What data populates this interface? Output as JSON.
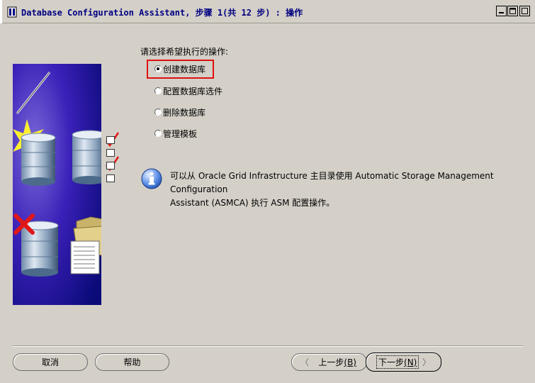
{
  "window": {
    "title": "Database Configuration Assistant, 步骤 1(共 12 步) : 操作",
    "minimize_icon": "minimize-icon",
    "maximize_icon": "maximize-icon",
    "close_icon": "close-icon"
  },
  "main": {
    "prompt": "请选择希望执行的操作:",
    "options": [
      {
        "label": "创建数据库",
        "selected": true
      },
      {
        "label": "配置数据库选件",
        "selected": false
      },
      {
        "label": "删除数据库",
        "selected": false
      },
      {
        "label": "管理模板",
        "selected": false
      }
    ],
    "info_line1": "可以从 Oracle Grid Infrastructure 主目录使用 Automatic Storage Management Configuration",
    "info_line2": "Assistant (ASMCA) 执行 ASM 配置操作。",
    "highlight_color": "#e01010"
  },
  "footer": {
    "cancel": "取消",
    "help": "帮助",
    "back_text": "上一步",
    "back_mnemonic": "(B)",
    "next_text": "下一步",
    "next_mnemonic": "(N)",
    "back_arrow": "〈",
    "next_arrow": "〉"
  }
}
